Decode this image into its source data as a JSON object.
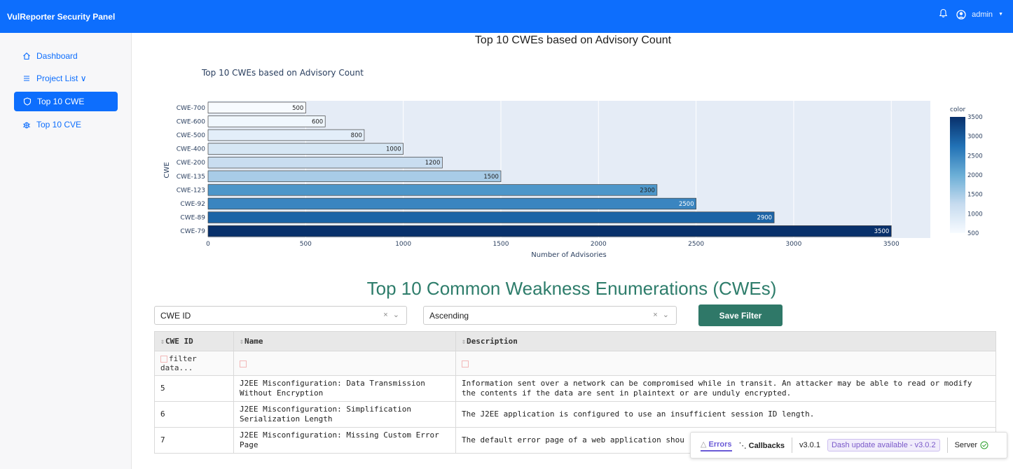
{
  "header": {
    "brand": "VulReporter Security Panel",
    "user": "admin"
  },
  "sidebar": {
    "items": [
      {
        "label": "Dashboard",
        "icon": "home-icon"
      },
      {
        "label": "Project List ∨",
        "icon": "list-icon"
      },
      {
        "label": "Top 10 CWE",
        "icon": "shield-icon",
        "active": true
      },
      {
        "label": "Top 10 CVE",
        "icon": "bug-icon"
      }
    ]
  },
  "page_title": "Top 10 CWEs based on Advisory Count",
  "chart_data": {
    "type": "bar",
    "orientation": "horizontal",
    "title": "Top 10 CWEs based on Advisory Count",
    "xlabel": "Number of Advisories",
    "ylabel": "CWE",
    "categories": [
      "CWE-700",
      "CWE-600",
      "CWE-500",
      "CWE-400",
      "CWE-200",
      "CWE-135",
      "CWE-123",
      "CWE-92",
      "CWE-89",
      "CWE-79"
    ],
    "values": [
      500,
      600,
      800,
      1000,
      1200,
      1500,
      2300,
      2500,
      2900,
      3500
    ],
    "xlim": [
      0,
      3700
    ],
    "xticks": [
      0,
      500,
      1000,
      1500,
      2000,
      2500,
      3000,
      3500
    ],
    "grid": true,
    "colorbar": {
      "title": "color",
      "ticks": [
        500,
        1000,
        1500,
        2000,
        2500,
        3000,
        3500
      ]
    }
  },
  "section_title": "Top 10 Common Weakness Enumerations (CWEs)",
  "filters": {
    "column_select": "CWE ID",
    "order_select": "Ascending",
    "clear_symbol": "× ⌄",
    "save_label": "Save Filter"
  },
  "table": {
    "sort_symbol": "⇕",
    "columns": [
      "CWE ID",
      "Name",
      "Description"
    ],
    "filter_placeholder": "filter data...",
    "rows": [
      {
        "id": "5",
        "name": "J2EE Misconfiguration: Data Transmission Without Encryption",
        "description": "Information sent over a network can be compromised while in transit. An attacker may be able to read or modify the contents if the data are sent in plaintext or are unduly encrypted."
      },
      {
        "id": "6",
        "name": "J2EE Misconfiguration: Simplification Serialization Length",
        "description": "The J2EE application is configured to use an insufficient session ID length."
      },
      {
        "id": "7",
        "name": "J2EE Misconfiguration: Missing Custom Error Page",
        "description": "The default error page of a web application shou"
      }
    ]
  },
  "dash": {
    "errors": "Errors",
    "callbacks": "Callbacks",
    "version": "v3.0.1",
    "update": "Dash update available - v3.0.2",
    "server": "Server"
  }
}
